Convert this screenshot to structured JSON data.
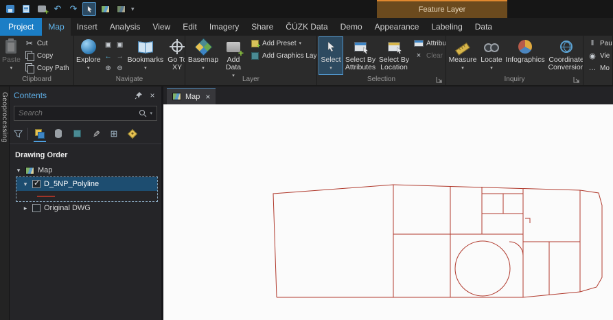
{
  "contextual": {
    "header": "Feature Layer"
  },
  "tabs": {
    "project": "Project",
    "map": "Map",
    "insert": "Insert",
    "analysis": "Analysis",
    "view": "View",
    "edit": "Edit",
    "imagery": "Imagery",
    "share": "Share",
    "cuzk": "ČÚZK Data",
    "demo": "Demo",
    "appearance": "Appearance",
    "labeling": "Labeling",
    "data": "Data"
  },
  "ribbon": {
    "clipboard": {
      "label": "Clipboard",
      "paste": "Paste",
      "cut": "Cut",
      "copy": "Copy",
      "copy_path": "Copy Path"
    },
    "navigate": {
      "label": "Navigate",
      "explore": "Explore",
      "bookmarks": "Bookmarks",
      "go_to_xy": "Go To XY"
    },
    "layer": {
      "label": "Layer",
      "basemap": "Basemap",
      "add_data": "Add Data",
      "add_preset": "Add Preset",
      "add_graphics_layer": "Add Graphics Layer"
    },
    "selection": {
      "label": "Selection",
      "select": "Select",
      "select_by_attributes": "Select By Attributes",
      "select_by_location": "Select By Location",
      "attributes": "Attributes",
      "clear": "Clear"
    },
    "inquiry": {
      "label": "Inquiry",
      "measure": "Measure",
      "locate": "Locate",
      "infographics": "Infographics",
      "coordinate_conversion": "Coordinate Conversion"
    },
    "overflow": {
      "pause": "Pau",
      "view": "Vie",
      "more": "Mo"
    }
  },
  "contents": {
    "title": "Contents",
    "search_placeholder": "Search",
    "section": "Drawing Order",
    "map_group": "Map",
    "layer_selected": "D_5NP_Polyline",
    "layer_dwg": "Original DWG"
  },
  "side": {
    "geoprocessing": "Geoprocessing"
  },
  "view": {
    "tab": "Map"
  },
  "colors": {
    "accent": "#4fa0e0",
    "project_tab": "#1b7ec6",
    "contextual_accent": "#e0882f",
    "selection_row": "#1d4d70",
    "drawing_line": "#b0392c",
    "canvas": "#fbfbfb"
  }
}
